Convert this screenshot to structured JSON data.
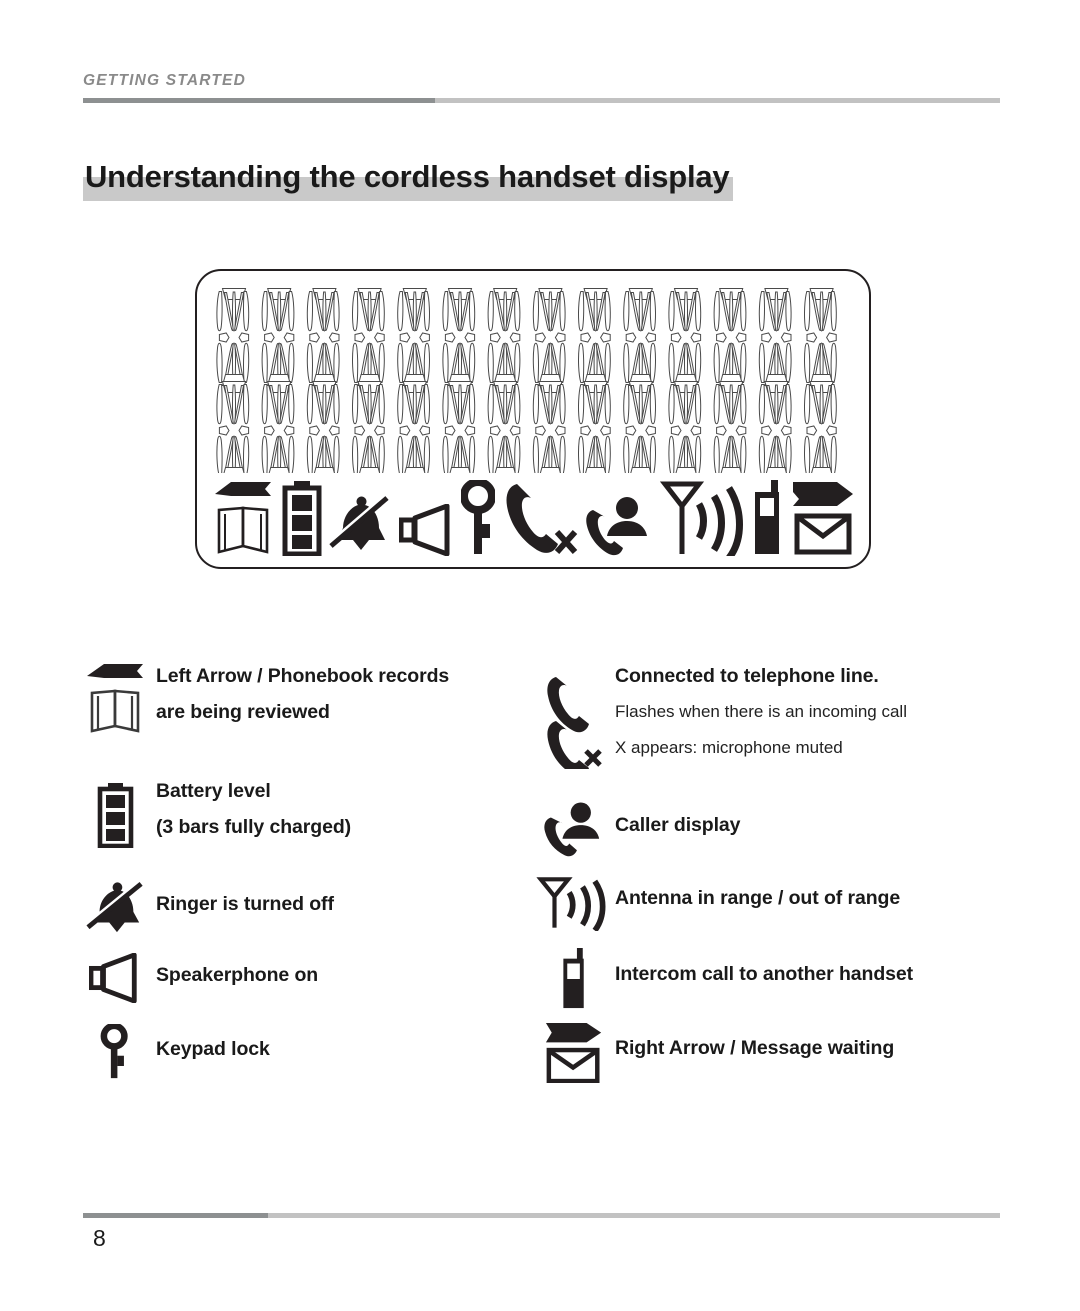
{
  "header": {
    "kicker": "GETTING STARTED",
    "title": "Understanding the cordless handset display"
  },
  "lcd_display": {
    "character_cells": 14,
    "segment_rows": 2,
    "status_icons": [
      "left-arrow-icon",
      "open-book-icon",
      "battery-icon",
      "ringer-off-icon",
      "speakerphone-icon",
      "key-icon",
      "handset-icon",
      "handset-muted-icon",
      "caller-display-icon",
      "antenna-icon",
      "intercom-handset-icon",
      "right-arrow-icon",
      "envelope-icon"
    ]
  },
  "legend": {
    "left_column": [
      {
        "icons": [
          "left-arrow-icon",
          "open-book-icon"
        ],
        "lines": [
          {
            "text": "Left Arrow / Phonebook records",
            "style": "bold"
          },
          {
            "text": "are being reviewed",
            "style": "bold"
          }
        ]
      },
      {
        "icons": [
          "battery-icon"
        ],
        "lines": [
          {
            "text": "Battery level",
            "style": "bold"
          },
          {
            "text": "(3 bars fully charged)",
            "style": "bold"
          }
        ]
      },
      {
        "icons": [
          "ringer-off-icon"
        ],
        "lines": [
          {
            "text": "Ringer is turned off",
            "style": "bold"
          }
        ]
      },
      {
        "icons": [
          "speakerphone-icon"
        ],
        "lines": [
          {
            "text": "Speakerphone on",
            "style": "bold"
          }
        ]
      },
      {
        "icons": [
          "key-icon"
        ],
        "lines": [
          {
            "text": "Keypad lock",
            "style": "bold"
          }
        ]
      }
    ],
    "right_column": [
      {
        "icons": [
          "handset-icon",
          "handset-muted-icon"
        ],
        "lines": [
          {
            "text": "Connected to telephone line.",
            "style": "bold"
          },
          {
            "text": "Flashes when there is an incoming call",
            "style": "normal"
          },
          {
            "text": "X appears: microphone muted",
            "style": "normal"
          }
        ]
      },
      {
        "icons": [
          "caller-display-icon"
        ],
        "lines": [
          {
            "text": "Caller display",
            "style": "bold"
          }
        ]
      },
      {
        "icons": [
          "antenna-icon"
        ],
        "lines": [
          {
            "text": "Antenna in range / out of range",
            "style": "bold"
          }
        ]
      },
      {
        "icons": [
          "intercom-handset-icon"
        ],
        "lines": [
          {
            "text": "Intercom call to another handset",
            "style": "bold"
          }
        ]
      },
      {
        "icons": [
          "right-arrow-icon",
          "envelope-icon"
        ],
        "lines": [
          {
            "text": "Right Arrow / Message waiting",
            "style": "bold"
          }
        ]
      }
    ]
  },
  "footer": {
    "page_number": "8"
  },
  "colors": {
    "ink": "#1a1a1a",
    "rule_dark": "#8d9091",
    "rule_light": "#c2c2c2",
    "title_highlight": "#c9c9c9",
    "kicker": "#8a8a8a"
  }
}
